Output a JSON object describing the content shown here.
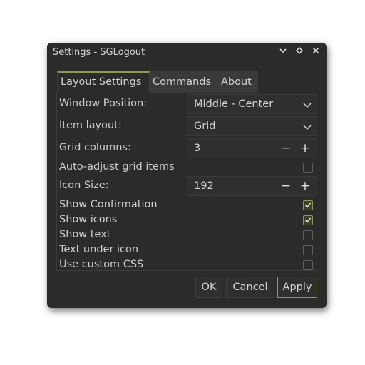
{
  "window": {
    "title": "Settings - SGLogout",
    "minimize_glyph": "⌄",
    "maximize_glyph": "◇",
    "close_glyph": "✕"
  },
  "tabs": [
    {
      "label": "Layout Settings",
      "active": true
    },
    {
      "label": "Commands",
      "active": false
    },
    {
      "label": "About",
      "active": false
    }
  ],
  "form": {
    "window_position": {
      "label": "Window Position:",
      "value": "Middle - Center"
    },
    "item_layout": {
      "label": "Item layout:",
      "value": "Grid"
    },
    "grid_columns": {
      "label": "Grid columns:",
      "value": "3",
      "minus": "−",
      "plus": "+"
    },
    "auto_adjust": {
      "label": "Auto-adjust grid items",
      "checked": false
    },
    "icon_size": {
      "label": "Icon Size:",
      "value": "192",
      "minus": "−",
      "plus": "+"
    },
    "show_confirmation": {
      "label": "Show Confirmation",
      "checked": true
    },
    "show_icons": {
      "label": "Show icons",
      "checked": true
    },
    "show_text": {
      "label": "Show text",
      "checked": false
    },
    "text_under_icon": {
      "label": "Text under icon",
      "checked": false
    },
    "use_custom_css": {
      "label": "Use custom CSS",
      "checked": false
    }
  },
  "buttons": {
    "ok": "OK",
    "cancel": "Cancel",
    "apply": "Apply"
  },
  "colors": {
    "background": "#2b2b2b",
    "accent": "#8d9a55",
    "text": "#cfcfcf"
  }
}
